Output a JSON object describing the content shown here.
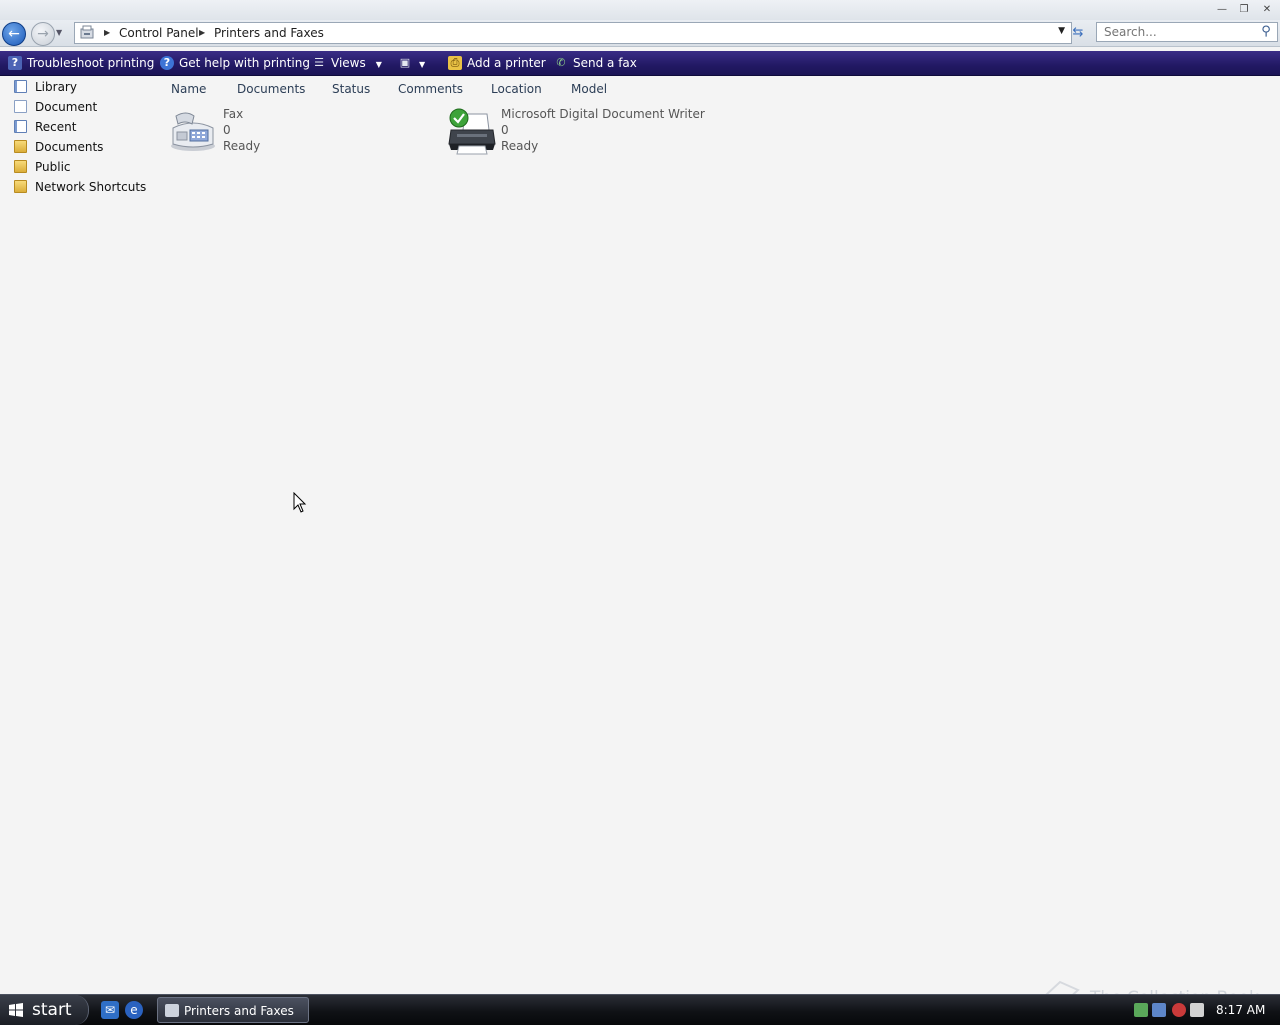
{
  "address_bar": {
    "crumbs": [
      "Control Panel",
      "Printers and Faxes"
    ]
  },
  "search": {
    "placeholder": "Search..."
  },
  "command_bar": {
    "troubleshoot": "Troubleshoot printing",
    "get_help": "Get help with printing",
    "views": "Views",
    "add_printer": "Add a printer",
    "send_fax": "Send a fax"
  },
  "left_pane": {
    "items": [
      "Library",
      "Document",
      "Recent",
      "Documents",
      "Public",
      "Network Shortcuts"
    ]
  },
  "columns": [
    "Name",
    "Documents",
    "Status",
    "Comments",
    "Location",
    "Model"
  ],
  "printers": [
    {
      "name": "Fax",
      "documents": "0",
      "status": "Ready",
      "icon": "fax-icon"
    },
    {
      "name": "Microsoft Digital Document Writer",
      "documents": "0",
      "status": "Ready",
      "icon": "printer-icon",
      "default": true
    }
  ],
  "taskbar": {
    "start_label": "start",
    "open_window": "Printers and Faxes",
    "clock": "8:17 AM"
  },
  "watermark": "The Collection Book",
  "colors": {
    "command_bar": "#221964",
    "back_button": "#1b59b8",
    "window_background": "#f4f4f4"
  }
}
